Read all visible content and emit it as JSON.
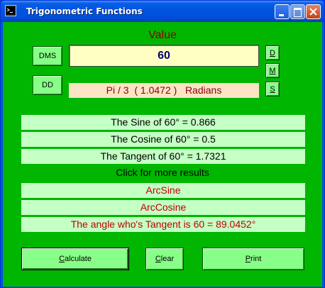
{
  "window": {
    "title": "Trigonometric Functions",
    "icon": "app-icon",
    "controls": [
      "minimize-icon",
      "maximize-icon",
      "close-icon"
    ]
  },
  "main": {
    "value_label": "Value",
    "value_input": "60",
    "radian_text": "Pi / 3  ( 1.0472 )   Radians",
    "dms_label": "DMS",
    "dd_label": "DD",
    "d_label": "D",
    "m_label": "M",
    "s_label": "S"
  },
  "results": {
    "sine": "The Sine of 60° = 0.866",
    "cosine": "The Cosine of 60° = 0.5",
    "tangent": "The Tangent of 60° = 1.7321",
    "more": "Click for more results",
    "arcsine": "ArcSine",
    "arccosine": "ArcCosine",
    "arctangent": "The angle who's Tangent is 60 = 89.0452°"
  },
  "buttons": {
    "calculate_first": "C",
    "calculate_rest": "alculate",
    "clear_first": "C",
    "clear_rest": "lear",
    "print_first": "P",
    "print_rest": "rint"
  },
  "colors": {
    "background": "#00b600",
    "button": "#88ff88",
    "result_row": "#c4ffc4",
    "value_box": "#ffffc4",
    "radian_box": "#fbe4c4",
    "accent_red": "#c00000",
    "title_red": "#8b0000"
  }
}
